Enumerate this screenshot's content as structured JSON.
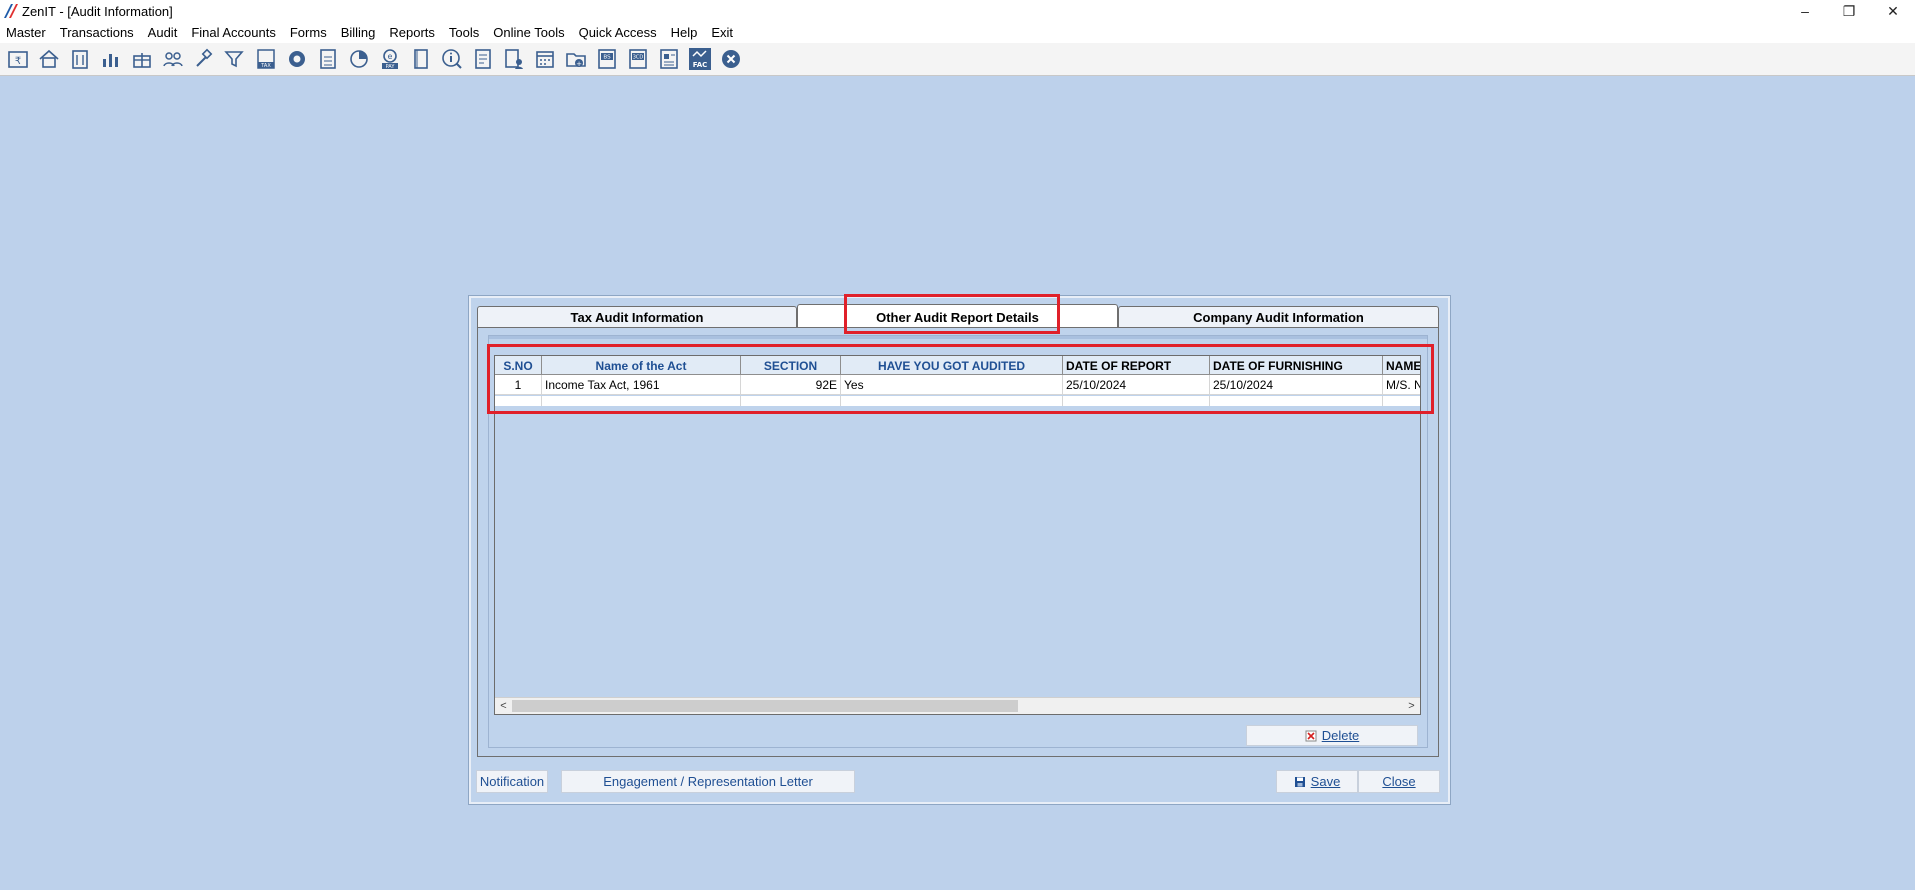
{
  "window": {
    "title": "ZenIT - [Audit Information]",
    "minimize": "–",
    "restore": "❐",
    "close": "✕"
  },
  "menu": [
    "Master",
    "Transactions",
    "Audit",
    "Final Accounts",
    "Forms",
    "Billing",
    "Reports",
    "Tools",
    "Online Tools",
    "Quick Access",
    "Help",
    "Exit"
  ],
  "toolbar": {
    "icons": [
      "rupee-book-icon",
      "home-icon",
      "building-icon",
      "bar-chart-icon",
      "gift-icon",
      "users-icon",
      "gavel-icon",
      "filter-icon",
      "tax-calculator-icon",
      "refresh-circle-icon",
      "calculator-icon",
      "pie-chart-icon",
      "e-pay-icon",
      "book-icon",
      "info-icon",
      "ledger-icon",
      "user-doc-icon",
      "calendar-icon",
      "folder-add-icon",
      "balance-sheet-icon",
      "3cd-icon",
      "report-icon",
      "fac-icon",
      "close-circle-icon"
    ],
    "pay_label": "PAY",
    "tax_label": "TAX",
    "bs_label": "BS",
    "cd_label": "3CD",
    "fac_label": "FAC"
  },
  "tabs": [
    {
      "label": "Tax Audit Information"
    },
    {
      "label": "Other Audit Report Details"
    },
    {
      "label": "Company Audit Information"
    }
  ],
  "grid": {
    "columns": [
      "S.NO",
      "Name of the Act",
      "SECTION",
      "HAVE YOU GOT AUDITED",
      "DATE OF REPORT",
      "DATE OF FURNISHING",
      "NAME"
    ],
    "rows": [
      [
        "1",
        "Income Tax Act, 1961",
        "92E",
        "Yes",
        "25/10/2024",
        "25/10/2024",
        "M/S. N"
      ]
    ],
    "scroll_left": "<",
    "scroll_right": ">"
  },
  "buttons": {
    "delete": "Delete",
    "notification": "Notification",
    "engagement": "Engagement / Representation Letter",
    "save": "Save",
    "close": "Close"
  },
  "colors": {
    "background": "#bdd1eb",
    "highlight": "#e0202a",
    "header_text_blue": "#1f4f93"
  }
}
